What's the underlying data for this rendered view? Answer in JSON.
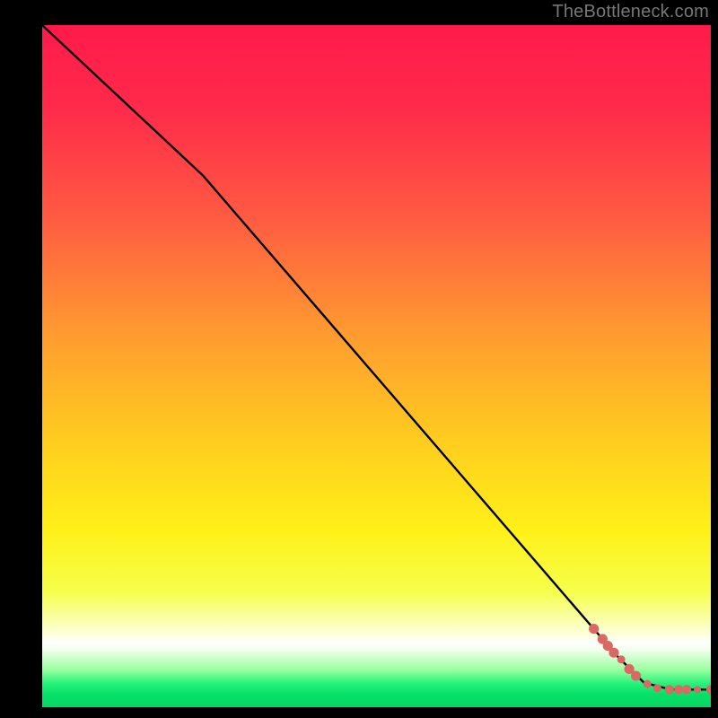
{
  "attribution": "TheBottleneck.com",
  "chart_data": {
    "type": "line",
    "title": "",
    "xlabel": "",
    "ylabel": "",
    "xlim": [
      0,
      100
    ],
    "ylim": [
      0,
      100
    ],
    "grid": false,
    "background": {
      "stops": [
        {
          "pos": 0.0,
          "color": "#ff1a4b"
        },
        {
          "pos": 0.12,
          "color": "#ff2a4a"
        },
        {
          "pos": 0.28,
          "color": "#ff5a42"
        },
        {
          "pos": 0.45,
          "color": "#ff9a30"
        },
        {
          "pos": 0.62,
          "color": "#ffd01e"
        },
        {
          "pos": 0.74,
          "color": "#fff018"
        },
        {
          "pos": 0.83,
          "color": "#f6ff4a"
        },
        {
          "pos": 0.895,
          "color": "#fdffe0"
        },
        {
          "pos": 0.905,
          "color": "#feffff"
        },
        {
          "pos": 0.915,
          "color": "#f4ffee"
        },
        {
          "pos": 0.945,
          "color": "#9affa0"
        },
        {
          "pos": 0.965,
          "color": "#27f37c"
        },
        {
          "pos": 0.98,
          "color": "#07e168"
        },
        {
          "pos": 1.0,
          "color": "#05d864"
        }
      ]
    },
    "series": [
      {
        "name": "curve",
        "color": "#000000",
        "points": [
          {
            "x": 0.0,
            "y": 100.0
          },
          {
            "x": 24.0,
            "y": 78.0
          },
          {
            "x": 86.0,
            "y": 7.5
          },
          {
            "x": 90.0,
            "y": 3.6
          },
          {
            "x": 94.0,
            "y": 2.6
          },
          {
            "x": 100.0,
            "y": 2.6
          }
        ]
      }
    ],
    "markers": {
      "name": "highlight-dots",
      "color": "#d86a63",
      "points": [
        {
          "x": 82.5,
          "y": 11.5,
          "r": 5.6
        },
        {
          "x": 83.8,
          "y": 10.0,
          "r": 5.6
        },
        {
          "x": 84.6,
          "y": 9.0,
          "r": 5.6
        },
        {
          "x": 85.5,
          "y": 8.0,
          "r": 5.6
        },
        {
          "x": 86.6,
          "y": 7.0,
          "r": 4.5
        },
        {
          "x": 87.8,
          "y": 5.6,
          "r": 5.6
        },
        {
          "x": 88.8,
          "y": 4.6,
          "r": 5.6
        },
        {
          "x": 90.5,
          "y": 3.4,
          "r": 4.5
        },
        {
          "x": 92.0,
          "y": 2.8,
          "r": 4.5
        },
        {
          "x": 93.8,
          "y": 2.6,
          "r": 5.1
        },
        {
          "x": 95.2,
          "y": 2.6,
          "r": 5.1
        },
        {
          "x": 96.4,
          "y": 2.6,
          "r": 5.1
        },
        {
          "x": 98.0,
          "y": 2.6,
          "r": 4.0
        },
        {
          "x": 100.0,
          "y": 2.6,
          "r": 5.1
        }
      ]
    }
  }
}
